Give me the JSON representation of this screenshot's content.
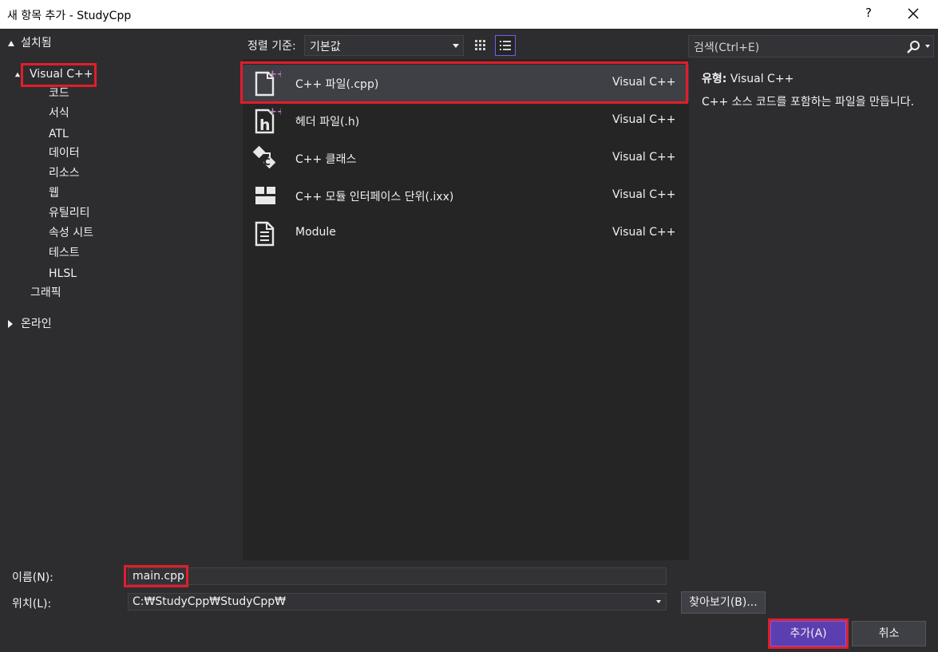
{
  "window": {
    "title": "새 항목 추가 - StudyCpp",
    "help_label": "?"
  },
  "tree": {
    "installed": "설치됨",
    "visual_cpp": "Visual C++",
    "children": [
      "코드",
      "서식",
      "ATL",
      "데이터",
      "리소스",
      "웹",
      "유틸리티",
      "속성 시트",
      "테스트",
      "HLSL"
    ],
    "graphics": "그래픽",
    "online": "온라인"
  },
  "toolbar": {
    "sort_label": "정렬 기준:",
    "sort_value": "기본값"
  },
  "templates": [
    {
      "name": "C++ 파일(.cpp)",
      "lang": "Visual C++",
      "icon": "cpp-file-icon"
    },
    {
      "name": "헤더 파일(.h)",
      "lang": "Visual C++",
      "icon": "header-file-icon"
    },
    {
      "name": "C++ 클래스",
      "lang": "Visual C++",
      "icon": "class-icon"
    },
    {
      "name": "C++ 모듈 인터페이스 단위(.ixx)",
      "lang": "Visual C++",
      "icon": "module-interface-icon"
    },
    {
      "name": "Module",
      "lang": "Visual C++",
      "icon": "module-icon"
    }
  ],
  "search": {
    "placeholder": "검색(Ctrl+E)"
  },
  "details": {
    "type_label": "유형:",
    "type_value": "Visual C++",
    "description": "C++ 소스 코드를 포함하는 파일을 만듭니다."
  },
  "form": {
    "name_label": "이름(N):",
    "name_value": "main.cpp",
    "location_label": "위치(L):",
    "location_value": "C:₩StudyCpp₩StudyCpp₩",
    "browse_label": "찾아보기(B)...",
    "add_label": "추가(A)",
    "cancel_label": "취소"
  },
  "colors": {
    "highlight": "#e11d2a",
    "accent": "#7160e8",
    "icon_plus": "#c586c0"
  }
}
